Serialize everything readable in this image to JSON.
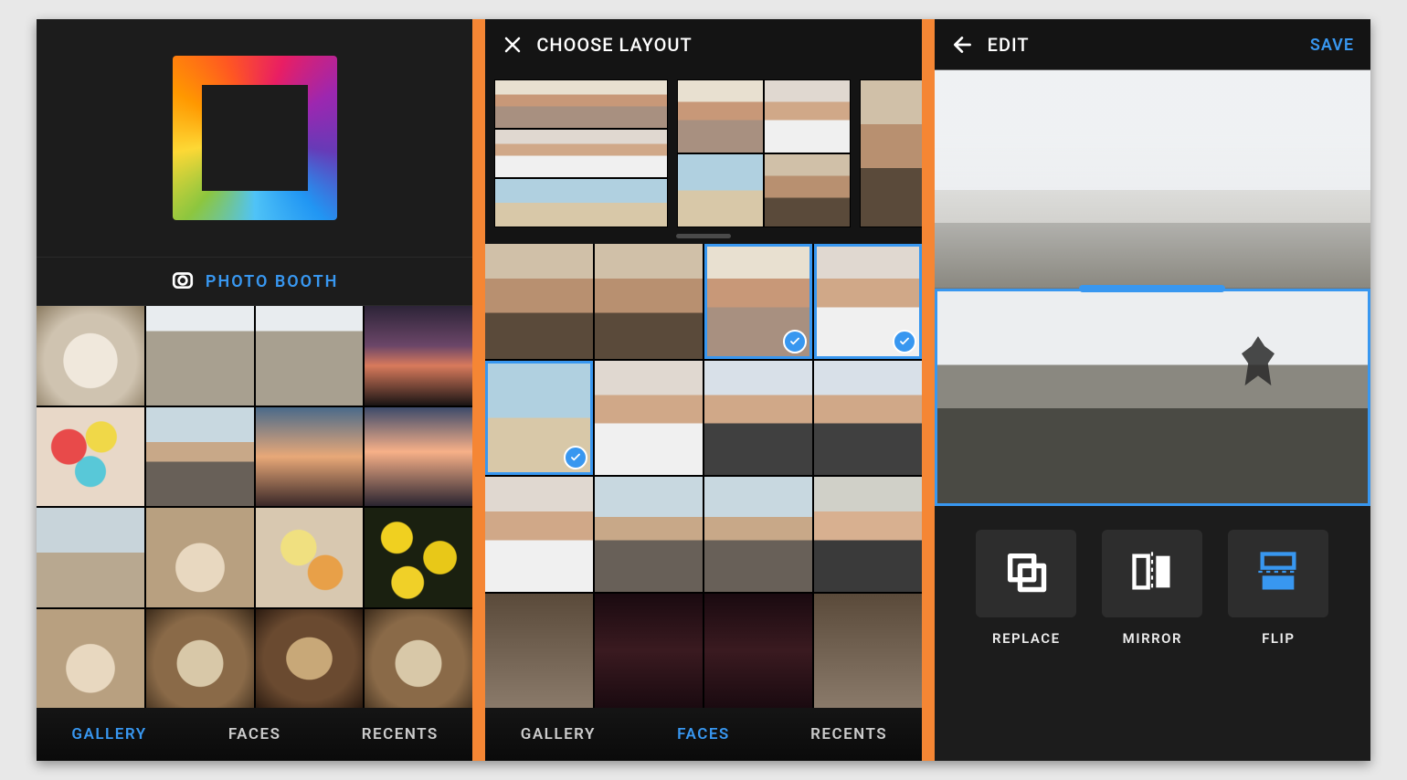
{
  "colors": {
    "accent": "#3897f0",
    "divider": "#f58634",
    "bg_dark": "#1a1a1a"
  },
  "screen1": {
    "photo_booth_label": "PHOTO BOOTH",
    "tabs": {
      "gallery": "GALLERY",
      "faces": "FACES",
      "recents": "RECENTS"
    },
    "active_tab": "GALLERY",
    "gallery_thumbs": [
      "dog-on-rug",
      "person-on-rocks",
      "cliff-sitter",
      "sunset-horizon",
      "balloons",
      "curly-hair-smile",
      "sunset-palm",
      "sunset-palm-2",
      "kid-by-wall",
      "breakfast-plates",
      "yellow-bouquet",
      "yellow-leaves-bike",
      "plated-dish",
      "dog-puppy-1",
      "dog-puppy-2",
      "dog-puppy-3"
    ]
  },
  "screen2": {
    "header_title": "CHOOSE LAYOUT",
    "close_label": "close",
    "layout_options": [
      "three-horizontal-rows",
      "two-by-two",
      "single-column"
    ],
    "tabs": {
      "gallery": "GALLERY",
      "faces": "FACES",
      "recents": "RECENTS"
    },
    "active_tab": "FACES",
    "face_thumbs": [
      {
        "name": "two-women-curly",
        "selected": false
      },
      {
        "name": "two-women-curly-2",
        "selected": false
      },
      {
        "name": "couple-kiss",
        "selected": true
      },
      {
        "name": "three-friends-selfie",
        "selected": true
      },
      {
        "name": "hand-on-head-beach",
        "selected": true
      },
      {
        "name": "woman-white-sweater",
        "selected": false
      },
      {
        "name": "girl-windblown",
        "selected": false
      },
      {
        "name": "redhead-beach",
        "selected": false
      },
      {
        "name": "woman-sunglasses",
        "selected": false
      },
      {
        "name": "beard-silly-face",
        "selected": false
      },
      {
        "name": "two-silly-faces",
        "selected": false
      },
      {
        "name": "man-glasses-smile",
        "selected": false
      },
      {
        "name": "woman-phone-indoor",
        "selected": false
      },
      {
        "name": "group-night-out",
        "selected": false
      },
      {
        "name": "group-night-out-2",
        "selected": false
      },
      {
        "name": "dad-holding-child",
        "selected": false
      }
    ]
  },
  "screen3": {
    "header_title": "EDIT",
    "back_label": "back",
    "save_label": "SAVE",
    "panes": [
      {
        "name": "top-pane-mountain-flipped",
        "selected": false
      },
      {
        "name": "bottom-pane-mountain-jumper",
        "selected": true
      }
    ],
    "tools": {
      "replace": "REPLACE",
      "mirror": "MIRROR",
      "flip": "FLIP"
    }
  }
}
